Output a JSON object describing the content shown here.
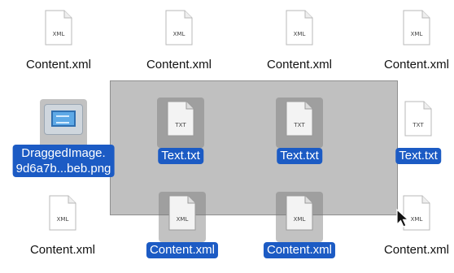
{
  "files": [
    {
      "label": "Content.xml",
      "ext": "XML",
      "selected": false,
      "kind": "doc"
    },
    {
      "label": "Content.xml",
      "ext": "XML",
      "selected": false,
      "kind": "doc"
    },
    {
      "label": "Content.xml",
      "ext": "XML",
      "selected": false,
      "kind": "doc"
    },
    {
      "label": "Content.xml",
      "ext": "XML",
      "selected": false,
      "kind": "doc"
    },
    {
      "label_line1": "DraggedImage.",
      "label_line2": "9d6a7b...beb.png",
      "selected": true,
      "kind": "image"
    },
    {
      "label": "Text.txt",
      "ext": "TXT",
      "selected": true,
      "kind": "doc"
    },
    {
      "label": "Text.txt",
      "ext": "TXT",
      "selected": true,
      "kind": "doc"
    },
    {
      "label": "Text.txt",
      "ext": "TXT",
      "selected": true,
      "kind": "doc"
    },
    {
      "label": "Content.xml",
      "ext": "XML",
      "selected": false,
      "kind": "doc"
    },
    {
      "label": "Content.xml",
      "ext": "XML",
      "selected": true,
      "kind": "doc"
    },
    {
      "label": "Content.xml",
      "ext": "XML",
      "selected": true,
      "kind": "doc"
    },
    {
      "label": "Content.xml",
      "ext": "XML",
      "selected": false,
      "kind": "doc"
    }
  ],
  "colors": {
    "selection_label": "#1c5bc4",
    "marquee": "rgba(140,140,140,0.55)"
  }
}
